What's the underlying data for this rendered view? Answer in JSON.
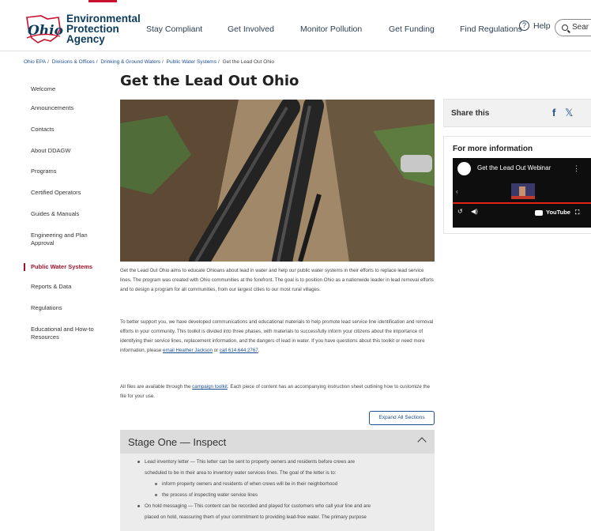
{
  "header": {
    "logo_word": "Ohio",
    "agency_lines": [
      "Environmental",
      "Protection",
      "Agency"
    ],
    "nav": [
      "Stay Compliant",
      "Get Involved",
      "Monitor Pollution",
      "Get Funding",
      "Find Regulations"
    ],
    "help_label": "Help",
    "search_label": "Sear"
  },
  "breadcrumb": [
    "Ohio EPA",
    "Divisions & Offices",
    "Drinking & Ground Waters",
    "Public Water Systems",
    "Get the Lead Out Ohio"
  ],
  "sidebar": {
    "items": [
      {
        "label": "Welcome"
      },
      {
        "label": "Announcements"
      },
      {
        "label": "Contacts"
      },
      {
        "label": "About DDAGW"
      },
      {
        "label": "Programs"
      },
      {
        "label": "Certified Operators"
      },
      {
        "label": "Guides & Manuals"
      },
      {
        "label": "Engineering and Plan Approval"
      },
      {
        "label": "Public Water Systems",
        "active": true
      },
      {
        "label": "Reports & Data"
      },
      {
        "label": "Regulations"
      },
      {
        "label": "Educational and How-to Resources"
      }
    ]
  },
  "main": {
    "title": "Get the Lead Out Ohio",
    "para1": "Get the Lead Out Ohio aims to educate Ohioans about lead in water and help our public water systems in their efforts to replace lead service lines. The program was created with Ohio communities at the forefront. The goal is to position Ohio as a nationwide leader in lead removal efforts and to design a program for all communities, from our largest cities to our most rural villages.",
    "para2_pre": "To better support you, we have developed communications and educational materials to help promote lead service line identification and removal efforts in your community. This toolkit is divided into three phases, with materials to successfully inform your citizens about the importance of identifying their service lines, replacement information, and the dangers of lead in water. If you have questions about this toolkit or need more information, please ",
    "para2_link1": "email Heather Jackson",
    "para2_mid": " or ",
    "para2_link2": "call 614.644.2767",
    "para2_end": ".",
    "para3_pre": "All files are available through the ",
    "para3_link": "campaign toolkit",
    "para3_post": ". Each piece of content has an accompanying instruction sheet outlining how to customize the file for your use.",
    "expand_label": "Expand All Sections",
    "stage": {
      "title": "Stage One — Inspect",
      "b1_l1": "Lead inventory letter — This letter can be sent to property owners and residents before crews are",
      "b1_l2": "scheduled to be in their area to inventory water services lines. The goal of the letter is to:",
      "sub1": "inform property owners and residents of when crews will be in their neighborhood",
      "sub2": "the process of inspecting water service lines",
      "b2_l1": "On hold messaging — This content can be recorded and played for customers who call your line and are",
      "b2_l2": "placed on hold, reassuring them of your commitment to providing lead-free water. The primary purpose"
    }
  },
  "right": {
    "share_label": "Share this",
    "more_label": "For more information",
    "video_title": "Get the Lead Out Webinar",
    "video_brand": "YouTube",
    "video_progress": 1.0
  }
}
